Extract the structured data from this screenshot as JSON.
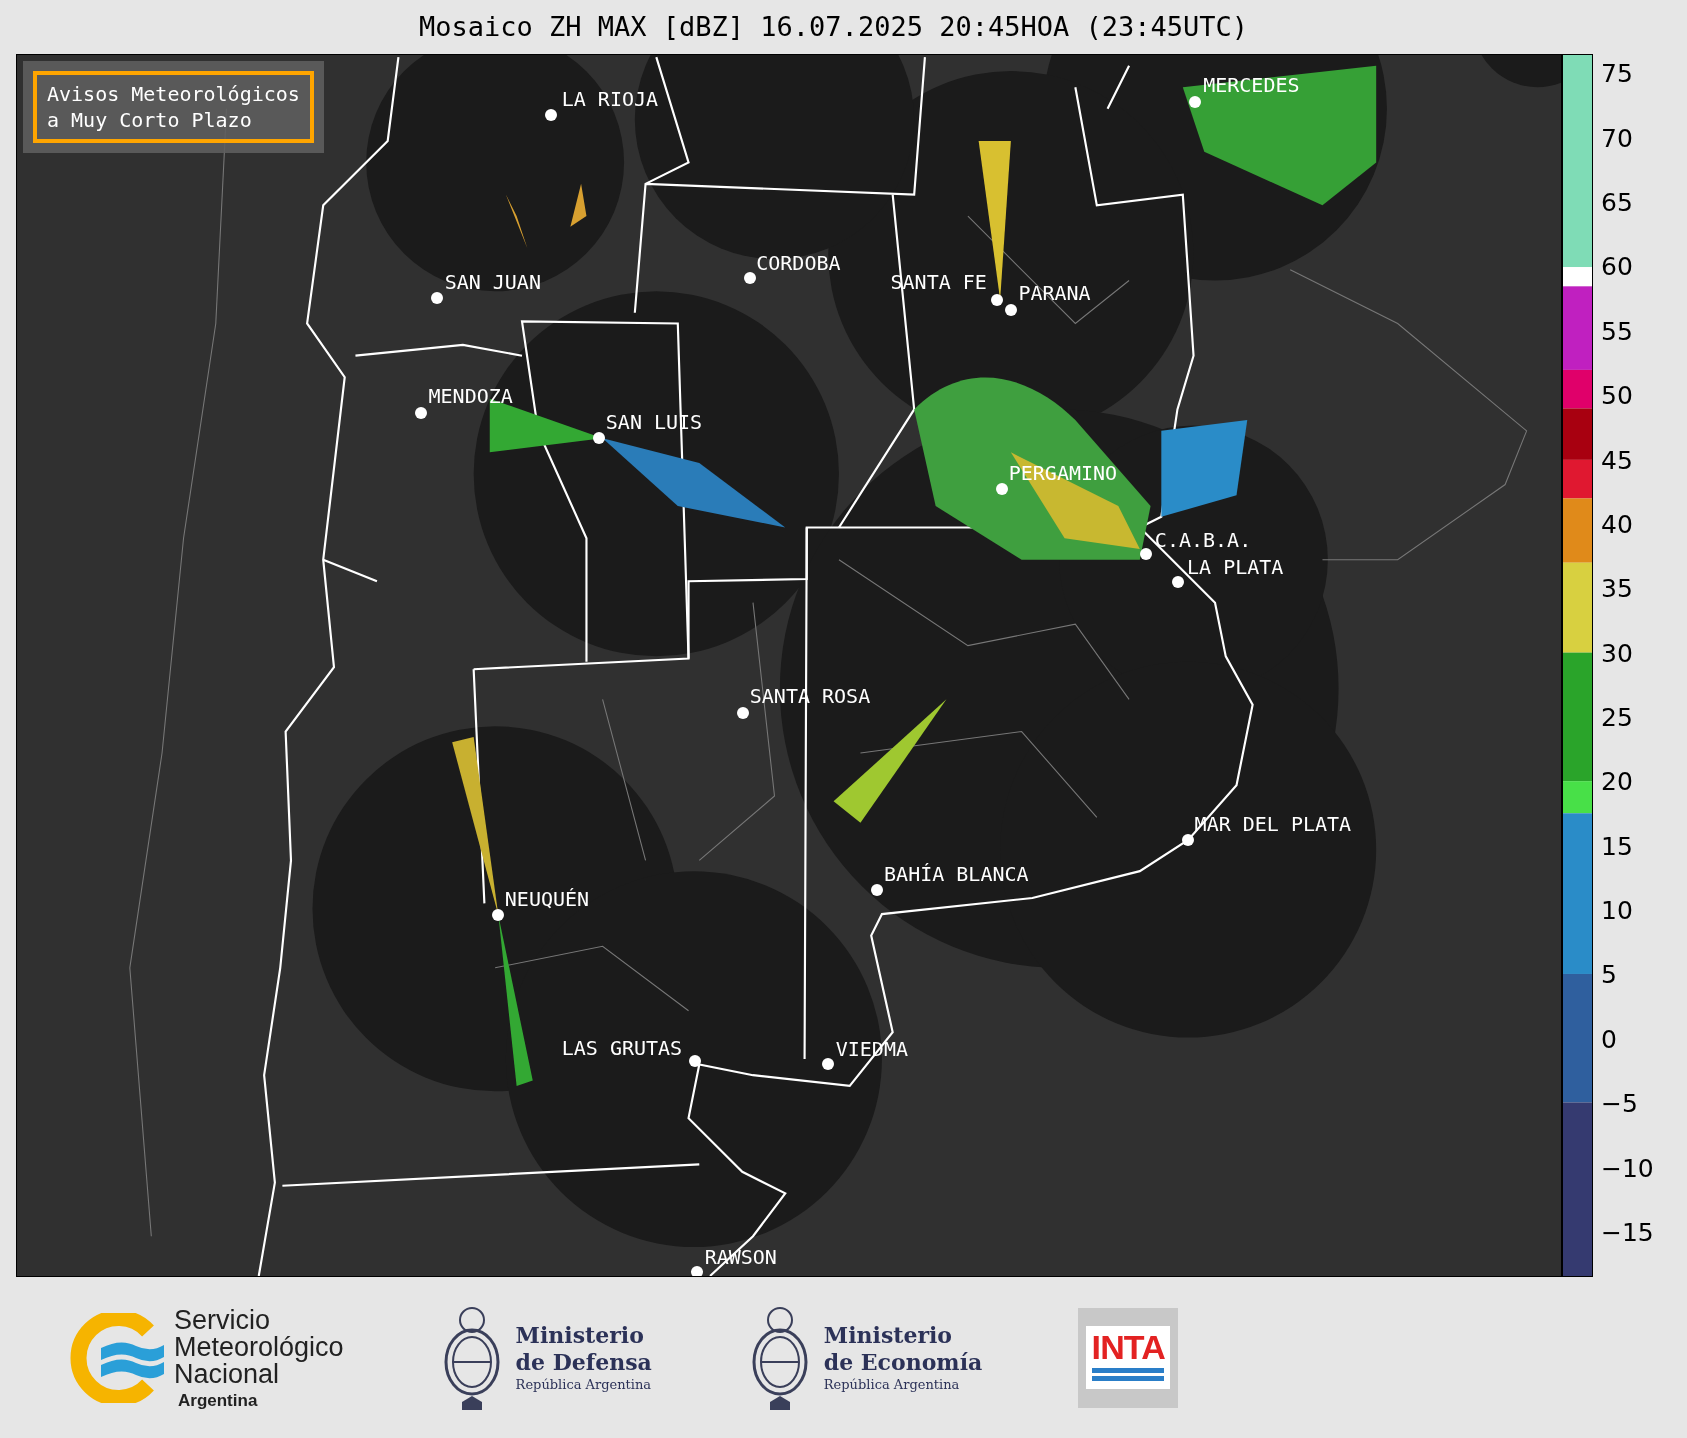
{
  "title": "Mosaico ZH MAX [dBZ] 16.07.2025 20:45HOA (23:45UTC)",
  "warning_box": {
    "lines": [
      "Avisos Meteorológicos",
      "a Muy Corto Plazo"
    ]
  },
  "cities": [
    {
      "name": "LA RIOJA"
    },
    {
      "name": "MERCEDES"
    },
    {
      "name": "CORDOBA"
    },
    {
      "name": "SAN JUAN"
    },
    {
      "name": "SANTA FE"
    },
    {
      "name": "PARANA"
    },
    {
      "name": "MENDOZA"
    },
    {
      "name": "SAN LUIS"
    },
    {
      "name": "PERGAMINO"
    },
    {
      "name": "C.A.B.A."
    },
    {
      "name": "LA PLATA"
    },
    {
      "name": "SANTA ROSA"
    },
    {
      "name": "MAR DEL PLATA"
    },
    {
      "name": "BAHÍA BLANCA"
    },
    {
      "name": "NEUQUÉN"
    },
    {
      "name": "LAS GRUTAS"
    },
    {
      "name": "VIEDMA"
    },
    {
      "name": "RAWSON"
    }
  ],
  "colorbar": {
    "ticks": [
      "75",
      "70",
      "65",
      "60",
      "55",
      "50",
      "45",
      "40",
      "35",
      "30",
      "25",
      "20",
      "15",
      "10",
      "5",
      "0",
      "−5",
      "−10",
      "−15"
    ]
  },
  "logos": [
    {
      "kind": "smn",
      "lines": [
        "Servicio",
        "Meteorológico",
        "Nacional"
      ],
      "subtitle": "Argentina"
    },
    {
      "kind": "ministry",
      "lines": [
        "Ministerio",
        "de Defensa"
      ],
      "subtitle": "República Argentina"
    },
    {
      "kind": "ministry",
      "lines": [
        "Ministerio",
        "de Economía"
      ],
      "subtitle": "República Argentina"
    },
    {
      "kind": "inta",
      "text": "INTA"
    }
  ]
}
